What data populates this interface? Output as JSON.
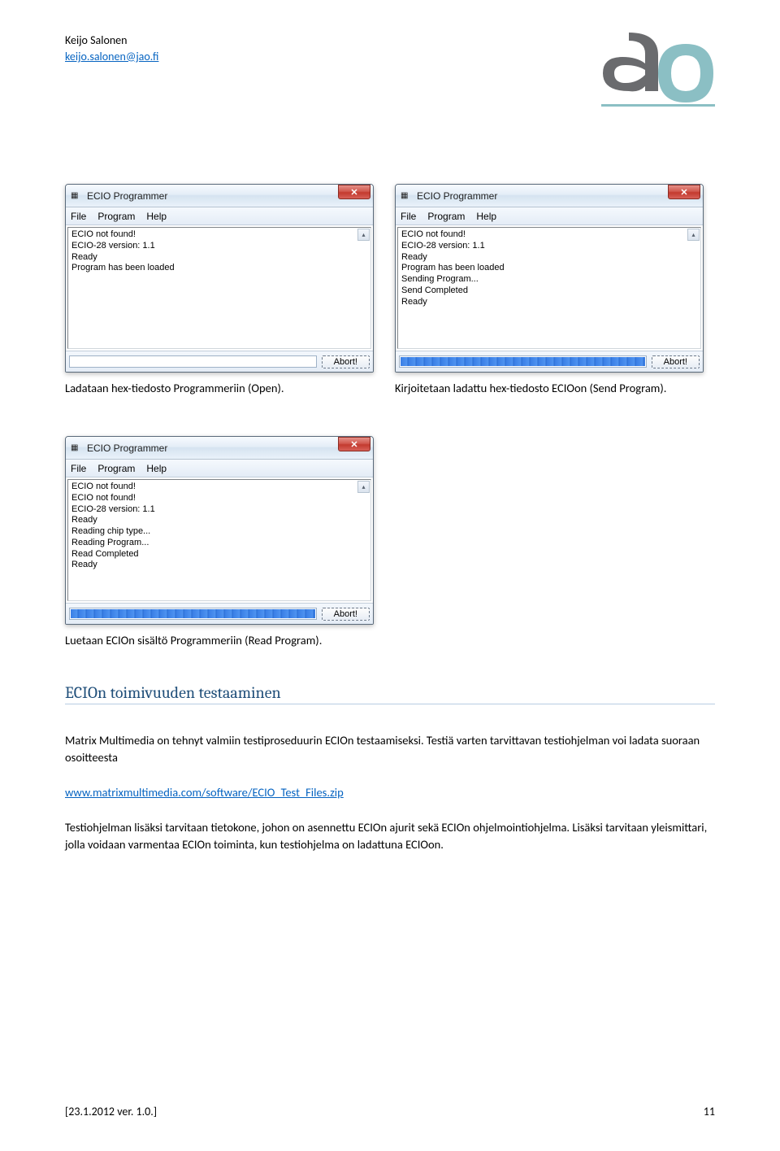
{
  "header": {
    "author": "Keijo Salonen",
    "email": "keijo.salonen@jao.fi"
  },
  "windows": {
    "w1": {
      "title": "ECIO Programmer",
      "menu": [
        "File",
        "Program",
        "Help"
      ],
      "lines": [
        "ECIO not found!",
        "ECIO-28 version: 1.1",
        "Ready",
        "Program has been loaded"
      ],
      "abort": "Abort!"
    },
    "w2": {
      "title": "ECIO Programmer",
      "menu": [
        "File",
        "Program",
        "Help"
      ],
      "lines": [
        "ECIO not found!",
        "ECIO-28 version: 1.1",
        "Ready",
        "Program has been loaded",
        "Sending Program...",
        "Send Completed",
        "Ready"
      ],
      "abort": "Abort!"
    },
    "w3": {
      "title": "ECIO Programmer",
      "menu": [
        "File",
        "Program",
        "Help"
      ],
      "lines": [
        "ECIO not found!",
        "ECIO not found!",
        "ECIO-28 version: 1.1",
        "Ready",
        "Reading chip type...",
        "Reading Program...",
        "Read Completed",
        "Ready"
      ],
      "abort": "Abort!"
    }
  },
  "captions": {
    "c1": "Ladataan hex-tiedosto Programmeriin (Open).",
    "c2": "Kirjoitetaan ladattu hex-tiedosto ECIOon (Send Program).",
    "c3": "Luetaan ECIOn sisältö Programmeriin (Read Program)."
  },
  "section": {
    "title": "ECIOn toimivuuden testaaminen",
    "p1": "Matrix Multimedia on tehnyt valmiin testiproseduurin ECIOn testaamiseksi. Testiä varten tarvittavan testiohjelman voi ladata suoraan osoitteesta",
    "link": "www.matrixmultimedia.com/software/ECIO_Test_Files.zip",
    "p2": "Testiohjelman lisäksi tarvitaan tietokone, johon on asennettu ECIOn ajurit sekä ECIOn ohjelmointiohjelma. Lisäksi tarvitaan yleismittari, jolla voidaan varmentaa ECIOn toiminta, kun testiohjelma on ladattuna ECIOon."
  },
  "footer": {
    "left": "[23.1.2012 ver. 1.0.]",
    "right": "11"
  }
}
